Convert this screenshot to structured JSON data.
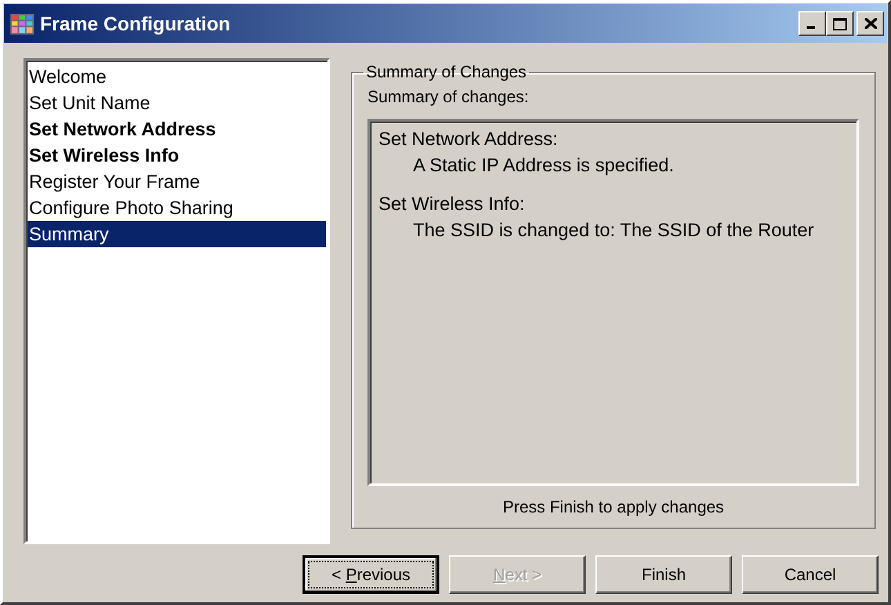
{
  "window": {
    "title": "Frame Configuration"
  },
  "steps": [
    {
      "label": "Welcome",
      "modified": false,
      "selected": false
    },
    {
      "label": "Set Unit Name",
      "modified": false,
      "selected": false
    },
    {
      "label": "Set Network Address",
      "modified": true,
      "selected": false
    },
    {
      "label": "Set Wireless Info",
      "modified": true,
      "selected": false
    },
    {
      "label": "Register Your Frame",
      "modified": false,
      "selected": false
    },
    {
      "label": "Configure Photo Sharing",
      "modified": false,
      "selected": false
    },
    {
      "label": "Summary",
      "modified": false,
      "selected": true
    }
  ],
  "group": {
    "title": "Summary of Changes",
    "caption": "Summary of changes:",
    "changes": [
      {
        "heading": "Set Network Address:",
        "detail": "A Static IP Address is specified."
      },
      {
        "heading": "Set Wireless Info:",
        "detail": "The SSID is changed to: The SSID of the Router"
      }
    ],
    "note": "Press Finish to apply changes"
  },
  "buttons": [
    {
      "before": "< ",
      "key": "P",
      "after": "revious",
      "disabled": false,
      "focused": true
    },
    {
      "key": "N",
      "after": "ext >",
      "disabled": true,
      "focused": false
    },
    {
      "before": "Finish",
      "disabled": false,
      "focused": false
    },
    {
      "before": "Cancel",
      "disabled": false,
      "focused": false
    }
  ]
}
